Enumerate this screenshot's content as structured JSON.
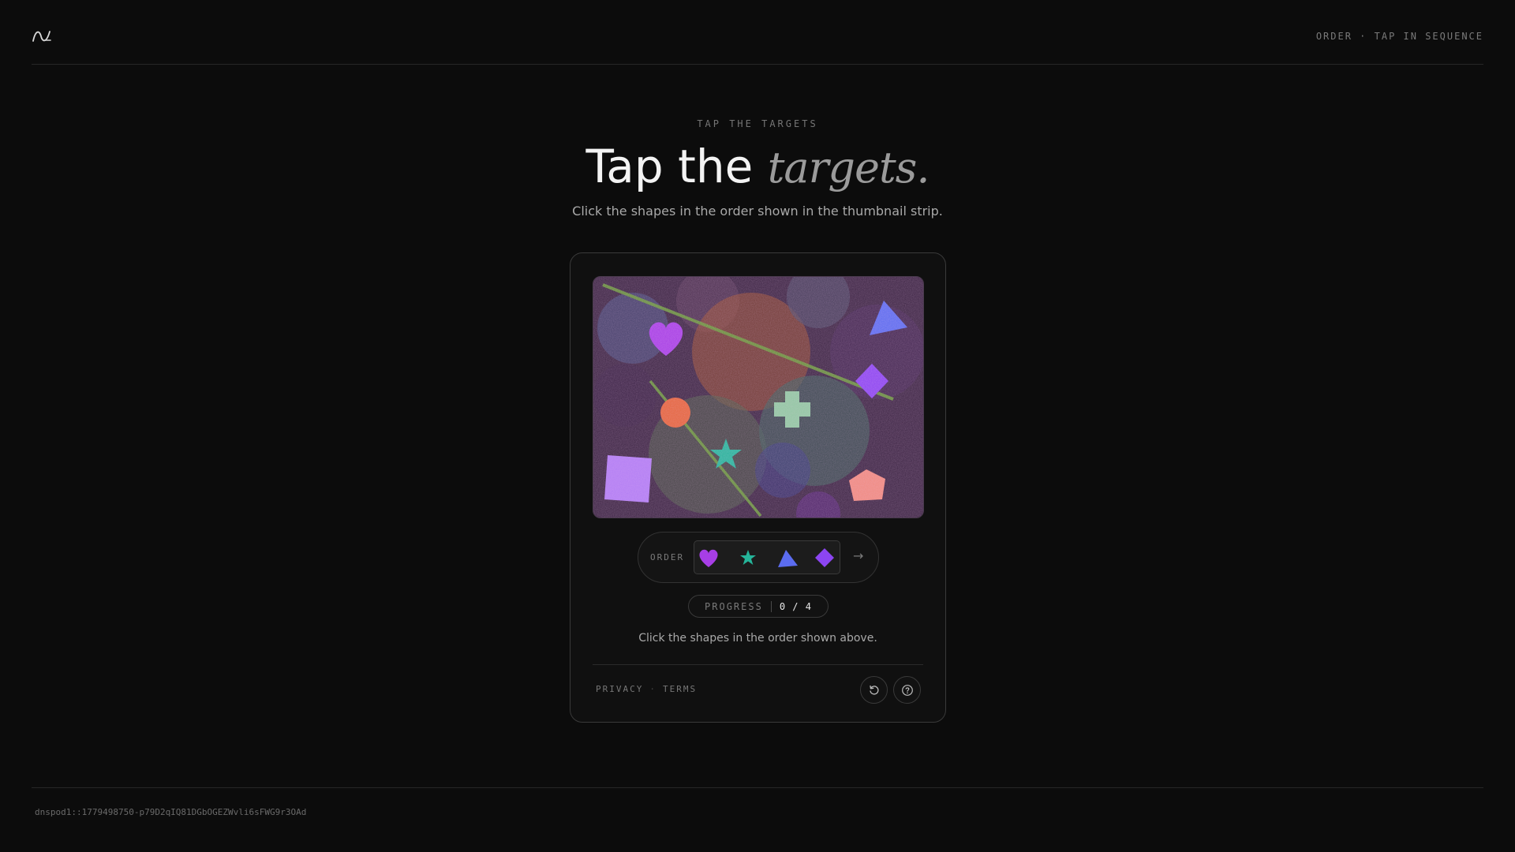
{
  "header": {
    "logo_icon": "wave-logo-icon",
    "status": "ORDER · TAP IN SEQUENCE"
  },
  "hero": {
    "eyebrow": "TAP THE TARGETS",
    "title_plain": "Tap the",
    "title_italic": "targets.",
    "subtitle": "Click the shapes in the order shown in the thumbnail strip."
  },
  "card": {
    "canvas": {
      "shapes": [
        {
          "name": "heart-target",
          "color": "#a73ee6"
        },
        {
          "name": "triangle-target",
          "color": "#5b6cf0"
        },
        {
          "name": "diamond-target",
          "color": "#8c45f2"
        },
        {
          "name": "cross-target",
          "color": "#8fc9a0"
        },
        {
          "name": "circle-target",
          "color": "#e5643a"
        },
        {
          "name": "star-target",
          "color": "#25b59a"
        },
        {
          "name": "square-target",
          "color": "#b17cf5"
        },
        {
          "name": "pentagon-target",
          "color": "#f08a7e"
        }
      ]
    },
    "order": {
      "label": "ORDER",
      "sequence": [
        "heart",
        "star",
        "triangle",
        "diamond"
      ],
      "arrow": "→"
    },
    "progress": {
      "label": "PROGRESS",
      "value": "0 / 4"
    },
    "instruction": "Click the shapes in the order shown above.",
    "footer": {
      "privacy": "PRIVACY",
      "separator": "·",
      "terms": "TERMS",
      "refresh_icon": "refresh-icon",
      "help_icon": "help-icon"
    }
  },
  "footer": {
    "id": "dnspod1::1779498750-p79D2qIQ81DGbOGEZWvli6sFWG9r3OAd"
  }
}
